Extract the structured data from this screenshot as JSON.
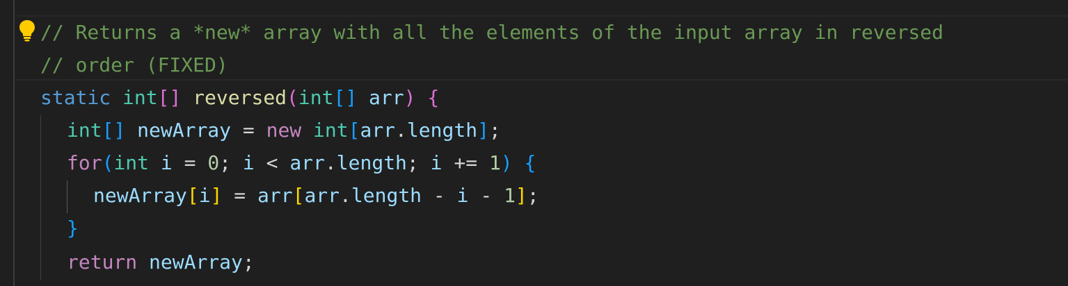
{
  "editor": {
    "colors": {
      "background": "#1f1f1f",
      "comment": "#6a9955",
      "keyword": "#569cd6",
      "control": "#c586c0",
      "type": "#4ec9b0",
      "function": "#dcdcaa",
      "variable": "#9cdcfe",
      "number": "#b5cea8",
      "bracket_gold": "#ffd700",
      "bracket_purple": "#da70d6",
      "bracket_blue": "#179fff"
    },
    "lightbulb_icon": "lightbulb-icon",
    "lines": {
      "l1": {
        "comment": "// Returns a *new* array with all the elements of the input array in reversed"
      },
      "l2": {
        "comment": "// order (FIXED)"
      },
      "l3": {
        "static": "static",
        "int1": "int",
        "br1": "[]",
        "name": "reversed",
        "paren_open": "(",
        "int2": "int",
        "br2": "[]",
        "param": "arr",
        "paren_close": ")",
        "brace_open": "{"
      },
      "l4": {
        "int1": "int",
        "br1": "[]",
        "var": "newArray",
        "eq": " = ",
        "new": "new",
        "int2": "int",
        "br_open": "[",
        "arr": "arr",
        "dot": ".",
        "length": "length",
        "br_close": "]",
        "semi": ";"
      },
      "l5": {
        "for": "for",
        "paren_open": "(",
        "int": "int",
        "i1": "i",
        "eq": " = ",
        "zero": "0",
        "semi1": "; ",
        "i2": "i",
        "lt": " < ",
        "arr": "arr",
        "dot": ".",
        "length": "length",
        "semi2": "; ",
        "i3": "i",
        "pluseq": " += ",
        "one": "1",
        "paren_close": ")",
        "brace_open": "{"
      },
      "l6": {
        "var": "newArray",
        "br_open1": "[",
        "i1": "i",
        "br_close1": "]",
        "eq": " = ",
        "arr1": "arr",
        "br_open2": "[",
        "arr2": "arr",
        "dot": ".",
        "length": "length",
        "minus1": " - ",
        "i2": "i",
        "minus2": " - ",
        "one": "1",
        "br_close2": "]",
        "semi": ";"
      },
      "l7": {
        "brace_close": "}"
      },
      "l8": {
        "return": "return",
        "var": "newArray",
        "semi": ";"
      }
    }
  }
}
